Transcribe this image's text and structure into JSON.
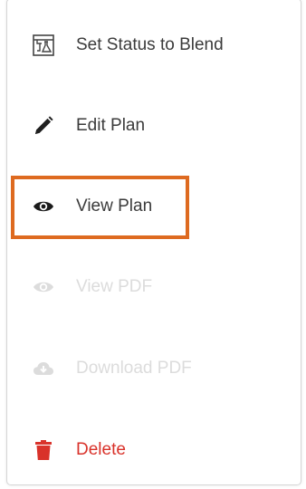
{
  "menu": {
    "items": [
      {
        "label": "Set Status to Blend",
        "icon": "flask-blend-icon",
        "state": "enabled"
      },
      {
        "label": "Edit Plan",
        "icon": "pencil-icon",
        "state": "enabled"
      },
      {
        "label": "View Plan",
        "icon": "eye-icon",
        "state": "enabled",
        "highlighted": true
      },
      {
        "label": "View PDF",
        "icon": "eye-icon",
        "state": "disabled"
      },
      {
        "label": "Download PDF",
        "icon": "cloud-download-icon",
        "state": "disabled"
      },
      {
        "label": "Delete",
        "icon": "trash-icon",
        "state": "danger"
      }
    ]
  },
  "colors": {
    "text": "#3b3b3b",
    "disabled": "#dcdcdc",
    "danger": "#d9322a",
    "highlight": "#de6a20"
  }
}
